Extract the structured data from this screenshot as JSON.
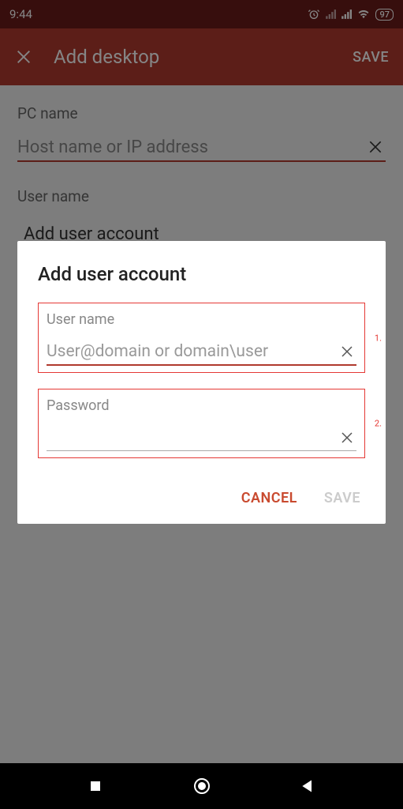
{
  "status": {
    "time": "9:44",
    "battery": "97"
  },
  "appbar": {
    "title": "Add desktop",
    "save": "SAVE"
  },
  "main": {
    "pc_label": "PC name",
    "pc_placeholder": "Host name or IP address",
    "user_label": "User name",
    "user_dropdown": "Add user account"
  },
  "dialog": {
    "title": "Add user account",
    "user_label": "User name",
    "user_placeholder": "User@domain or domain\\user",
    "password_label": "Password",
    "annot1": "1.",
    "annot2": "2.",
    "cancel": "CANCEL",
    "save": "SAVE"
  }
}
